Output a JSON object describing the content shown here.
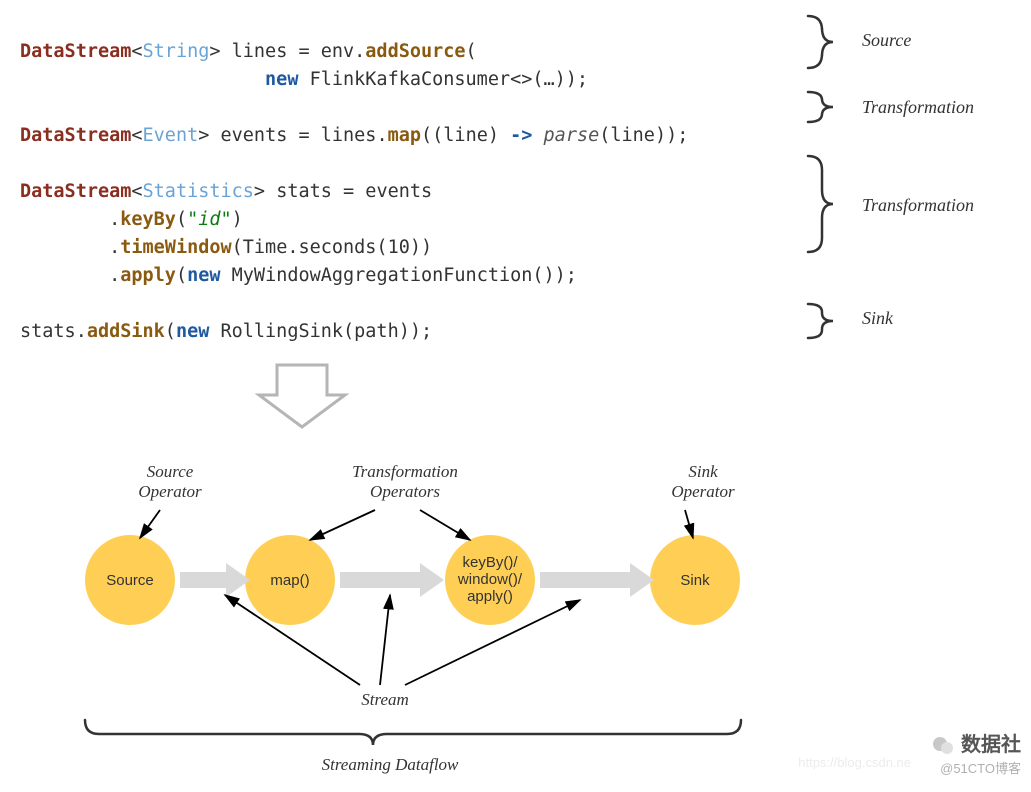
{
  "code": {
    "l1": {
      "type": "DataStream",
      "gen": "String",
      "var": " lines = env.",
      "m": "addSource",
      "tail": "("
    },
    "l2": {
      "kw": "new",
      "cls": " FlinkKafkaConsumer<>(…));"
    },
    "l3": {
      "type": "DataStream",
      "gen": "Event",
      "var": " events = lines.",
      "m": "map",
      "mid": "((line) ",
      "op": "->",
      "it": "parse",
      "tail": "(line));"
    },
    "l4": {
      "type": "DataStream",
      "gen": "Statistics",
      "var": " stats = events"
    },
    "l5": {
      "m": "keyBy",
      "arg": "\"id\"",
      "tail": ")"
    },
    "l6": {
      "m": "timeWindow",
      "arg": "Time.seconds(10))"
    },
    "l7": {
      "m": "apply",
      "kw": "new",
      "cls": " MyWindowAggregationFunction());"
    },
    "l8": {
      "var": "stats.",
      "m": "addSink",
      "kw": "new",
      "cls": " RollingSink(path));"
    }
  },
  "annotations": {
    "source": "Source",
    "transformation": "Transformation",
    "sink": "Sink"
  },
  "diagram": {
    "title_source_op": "Source\nOperator",
    "title_trans_ops": "Transformation\nOperators",
    "title_sink_op": "Sink\nOperator",
    "node_source": "Source",
    "node_map": "map()",
    "node_keyby": "keyBy()/\nwindow()/\napply()",
    "node_sink": "Sink",
    "stream": "Stream",
    "dataflow": "Streaming Dataflow"
  },
  "watermark": {
    "host": "https://blog.csdn.ne",
    "cn": "数据社",
    "sub": "@51CTO博客"
  }
}
